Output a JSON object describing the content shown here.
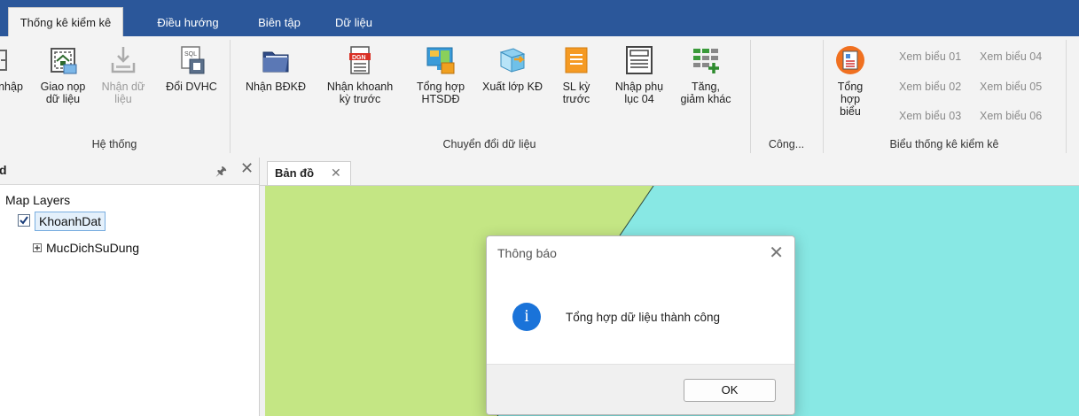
{
  "ribbon_tabs": [
    "Thống kê kiểm kê",
    "Điều hướng",
    "Biên tập",
    "Dữ liệu"
  ],
  "groups": {
    "he_thong": {
      "label": "Hệ thống",
      "buttons": [
        {
          "label": "nhập",
          "icon": "import-icon"
        },
        {
          "label": "Giao nọp\ndữ liệu",
          "icon": "submit-data-icon"
        },
        {
          "label": "Nhận dữ\nliệu",
          "icon": "receive-data-icon"
        },
        {
          "label": "Đổi DVHC",
          "icon": "sql-convert-icon"
        }
      ]
    },
    "chuyen_doi": {
      "label": "Chuyển đổi dữ liệu",
      "buttons": [
        {
          "label": "Nhận BĐKĐ",
          "icon": "folder-map-icon"
        },
        {
          "label": "Nhận khoanh\nkỳ trước",
          "icon": "dgn-file-icon"
        },
        {
          "label": "Tổng hợp\nHTSDĐ",
          "icon": "map-summary-icon"
        },
        {
          "label": "Xuất lớp KĐ",
          "icon": "export-layer-icon"
        },
        {
          "label": "SL kỳ\ntrước",
          "icon": "list-doc-icon"
        },
        {
          "label": "Nhập phụ\nlục 04",
          "icon": "form-doc-icon"
        },
        {
          "label": "Tăng,\ngiảm khác",
          "icon": "grid-plus-icon"
        }
      ]
    },
    "cong": {
      "label": "Công..."
    },
    "bieu": {
      "label": "Biểu thống kê kiểm kê",
      "main_button": {
        "label": "Tổng hợp\nbiểu",
        "icon": "report-icon"
      },
      "links": [
        "Xem biểu 01",
        "Xem biểu 04",
        "Xem biểu 02",
        "Xem biểu 05",
        "Xem biểu 03",
        "Xem biểu 06"
      ]
    }
  },
  "left_panel": {
    "title": "d",
    "root": "Map Layers",
    "layer": "KhoanhDat",
    "layer_checked": true,
    "child": "MucDichSuDung"
  },
  "doc_tab": {
    "label": "Bản đồ"
  },
  "dialog": {
    "title": "Thông báo",
    "message": "Tổng hợp dữ liệu thành công",
    "ok": "OK"
  },
  "colors": {
    "ribbon_blue": "#2b579a",
    "map_green": "#c4e684",
    "map_cyan": "#88e8e4",
    "info_blue": "#1a73d9"
  }
}
